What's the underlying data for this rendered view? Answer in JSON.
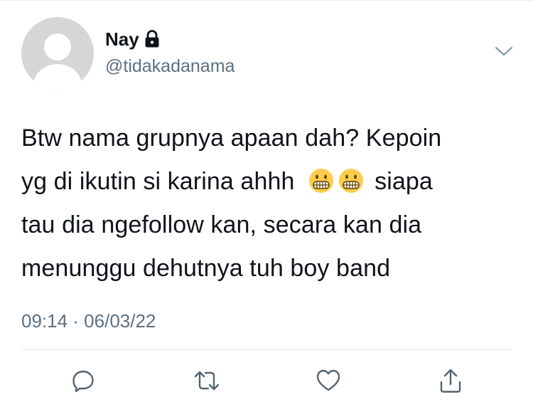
{
  "tweet": {
    "display_name": "Nay",
    "handle": "@tidakadanama",
    "text_lines": [
      "Btw nama grupnya apaan dah? Kepoin",
      "yg di ikutin si karina ahhh",
      "siapa",
      "tau dia ngefollow kan, secara kan dia",
      "menunggu dehutnya tuh boy band"
    ],
    "emoji": "grimacing-face",
    "emoji_count": 2,
    "timestamp": "09:14 · 06/03/22"
  },
  "icons": {
    "lock": "lock-icon",
    "menu": "chevron-down-icon",
    "reply": "reply-icon",
    "retweet": "retweet-icon",
    "like": "heart-icon",
    "share": "share-icon"
  },
  "colors": {
    "text": "#0f1419",
    "secondary": "#5b7083",
    "avatar_bg": "#d6d6d6",
    "icon": "#536471",
    "divider": "#e1e8ed"
  }
}
